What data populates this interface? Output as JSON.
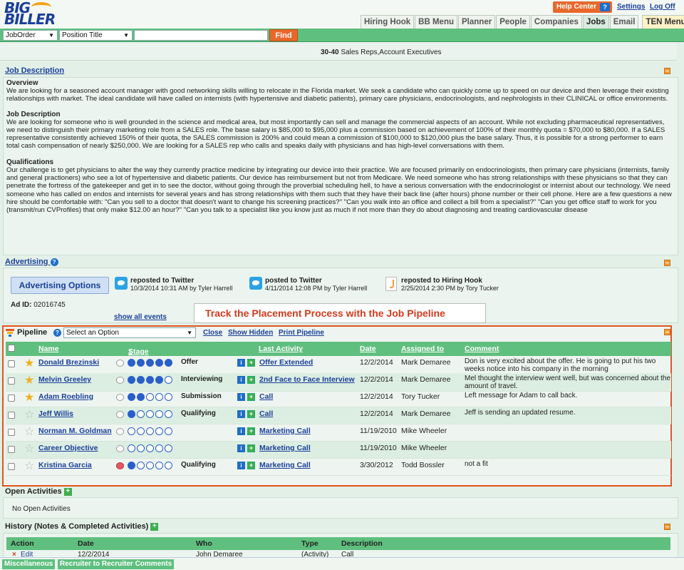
{
  "header": {
    "logo_line1": "BIG",
    "logo_line2": "BILLER",
    "help_center": "Help Center",
    "help_icon": "?",
    "settings": "Settings",
    "log_off": "Log Off",
    "tabs": [
      "Hiring Hook",
      "BB Menu",
      "Planner",
      "People",
      "Companies",
      "Jobs",
      "Email",
      "TEN Menu"
    ],
    "active_tab": "Jobs"
  },
  "searchbar": {
    "type_select": "JobOrder",
    "field_select": "Position Title",
    "query": "",
    "find_label": "Find"
  },
  "top_strip": {
    "line_bold": "30-40",
    "line_text": "Sales Reps,Account Executives"
  },
  "job_description": {
    "heading": "Job Description",
    "overview_title": "Overview",
    "overview_text": "We are looking for a seasoned account manager with good networking skills willing to relocate in the Florida market. We seek a candidate who can quickly come up to speed on our device and then leverage their existing relationships with market. The ideal candidate will have called on internists (with hypertensive and diabetic patients), primary care physicians, endocrinologists, and nephrologists in their CLINICAL or office environments.",
    "jd_title": "Job Description",
    "jd_text": "We are looking for someone who is well grounded in the science and medical area, but most importantly can sell and manage the commercial aspects of an account. While not excluding pharmaceutical representatives, we need to distinguish their primary marketing role from a SALES role. The base salary is $85,000 to $95,000 plus a commission based on achievement of 100% of their monthly quota = $70,000 to $80,000. If a SALES representative consistently achieved 150% of their quota, the SALES commission is 200% and could mean a commission of $100,000 to $120,000 plus the base salary. Thus, it is possible for a strong performer to earn total cash compensation of nearly $250,000. We are looking for a SALES rep who calls and speaks daily with physicians and has high-level conversations with them.",
    "qual_title": "Qualifications",
    "qual_text": "Our challenge is to get physicians to alter the way they currently practice medicine by integrating our device into their practice. We are focused primarily on endocrinologists, then primary care physicians (internists, family and general practioners) who see a lot of hypertensive and diabetic patients. Our device has reimbursement but not from Medicare. We need someone who has strong relationships with these physicians so that they can penetrate the fortress of the gatekeeper and get in to see the doctor, without going through the proverbial scheduling hell, to have a serious conversation with the endocrinologist or internist about our technology. We need someone who has called on endos and internists for several years and has strong relationships with them such that they have their back line (after hours) phone number or their cell phone. Here are a few questions a new hire should be comfortable with: \"Can you sell to a doctor that doesn't want to change his screening practices?\" \"Can you walk into an office and collect a bill from a specialist?\" \"Can you get office staff to work for you (transmit/run CVProfiles) that only make $12.00 an hour?\" \"Can you talk to a specialist like you know just as much if not more than they do about diagnosing and treating cardiovascular disease"
  },
  "advertising": {
    "heading": "Advertising",
    "options_button": "Advertising Options",
    "ad_id_label": "Ad ID:",
    "ad_id": "02016745",
    "show_all_events": "show all events",
    "posts": [
      {
        "title": "reposted to Twitter",
        "detail": "10/3/2014 10:31 AM by Tyler Harrell"
      },
      {
        "title": "posted to Twitter",
        "detail": "4/11/2014 12:08 PM by Tyler Harrell"
      },
      {
        "title": "reposted to Hiring Hook",
        "detail": "2/25/2014 2:30 PM by Tory Tucker"
      }
    ]
  },
  "callout": "Track the Placement Process with the Job Pipeline",
  "pipeline": {
    "title": "Pipeline",
    "select_placeholder": "Select an Option",
    "close": "Close",
    "show_hidden": "Show Hidden",
    "print": "Print Pipeline",
    "columns": [
      "Name",
      "Stage",
      "Last Activity",
      "Date",
      "Assigned to",
      "Comment"
    ],
    "rows": [
      {
        "name": "Donald Brezinski",
        "starred": true,
        "stage_filled": 5,
        "stage": "Offer",
        "activity": "Offer Extended",
        "date": "12/2/2014",
        "assigned": "Mark Demaree",
        "comment": "Don is very excited about the offer. He is going to put his two weeks notice into his company in the morning"
      },
      {
        "name": "Melvin Greeley",
        "starred": true,
        "stage_filled": 4,
        "stage": "Interviewing",
        "activity": "2nd Face to Face Interview",
        "date": "12/2/2014",
        "assigned": "Mark Demaree",
        "comment": "Mel thought the interview went well, but was concerned about the amount of travel."
      },
      {
        "name": "Adam Roebling",
        "starred": true,
        "stage_filled": 2,
        "stage": "Submission",
        "activity": "Call",
        "date": "12/2/2014",
        "assigned": "Tory Tucker",
        "comment": "Left message for Adam to call back."
      },
      {
        "name": "Jeff Willis",
        "starred": false,
        "stage_filled": 1,
        "stage": "Qualifying",
        "activity": "Call",
        "date": "12/2/2014",
        "assigned": "Mark Demaree",
        "comment": "Jeff is sending an updated resume."
      },
      {
        "name": "Norman M. Goldman",
        "starred": false,
        "stage_filled": 0,
        "stage": "",
        "activity": "Marketing Call",
        "date": "11/19/2010",
        "assigned": "Mike Wheeler",
        "comment": ""
      },
      {
        "name": "Career Objective",
        "starred": false,
        "stage_filled": 0,
        "stage": "",
        "activity": "Marketing Call",
        "date": "11/19/2010",
        "assigned": "Mike Wheeler",
        "comment": ""
      },
      {
        "name": "Kristina Garcia",
        "starred": false,
        "stage_filled": 1,
        "stage": "Qualifying",
        "activity": "Marketing Call",
        "date": "3/30/2012",
        "assigned": "Todd Bossler",
        "comment": "not a fit",
        "thumbs_down": true
      }
    ]
  },
  "open_activities": {
    "heading": "Open Activities",
    "empty_text": "No Open Activities"
  },
  "history": {
    "heading": "History (Notes & Completed Activities)",
    "columns": [
      "Action",
      "Date",
      "Who",
      "Type",
      "Description"
    ],
    "row": {
      "action": "Edit",
      "date": "12/2/2014",
      "who": "John Demaree",
      "type": "(Activity)",
      "description": "Call"
    }
  },
  "bottom_tabs": [
    "Miscellaneous",
    "Recruiter to Recruiter Comments"
  ]
}
